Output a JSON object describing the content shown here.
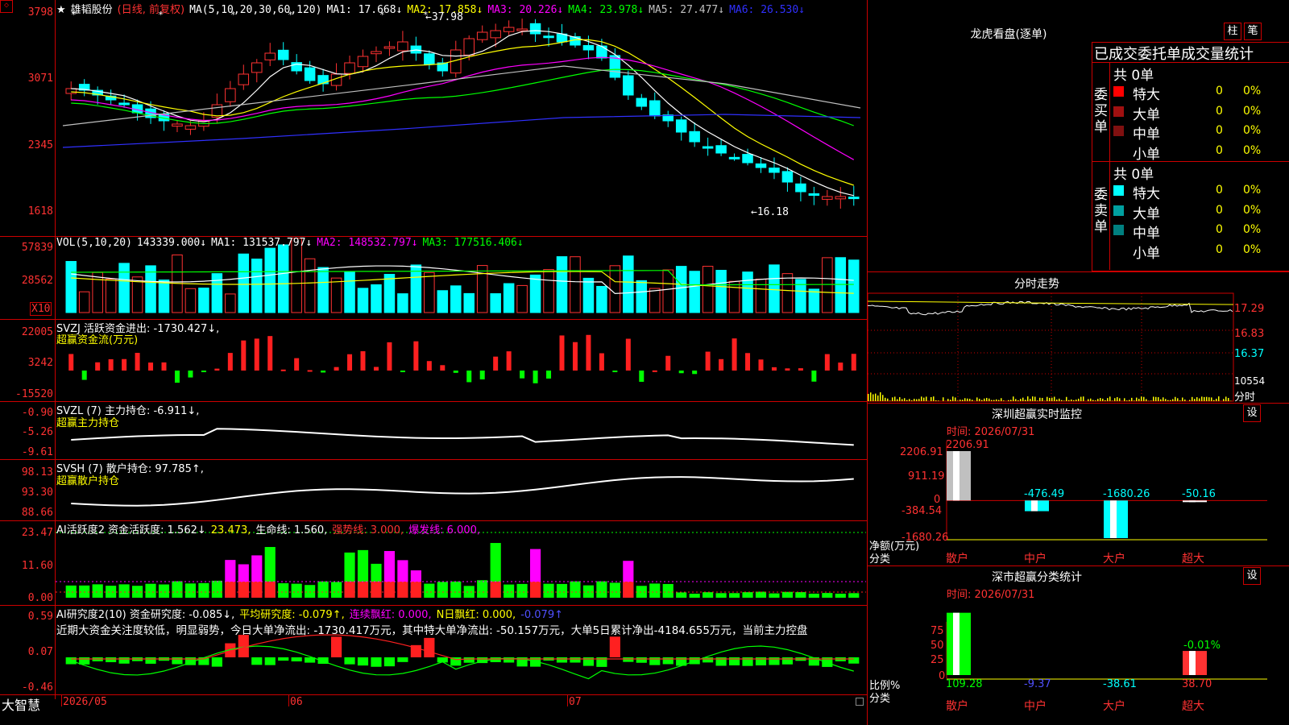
{
  "main": {
    "stock_name": "雄韬股份",
    "mode": "(日线, 前复权)",
    "ma_header": "MA(5,10,20,30,60,120)",
    "ma": [
      {
        "label": "MA1: 17.668↓",
        "color": "#ffffff"
      },
      {
        "label": "MA2: 17.858↓",
        "color": "#ffff00"
      },
      {
        "label": "MA3: 20.226↓",
        "color": "#ff00ff"
      },
      {
        "label": "MA4: 23.978↓",
        "color": "#00ff00"
      },
      {
        "label": "MA5: 27.477↓",
        "color": "#c0c0c0"
      },
      {
        "label": "MA6: 26.530↓",
        "color": "#3030ff"
      }
    ],
    "high_label": "←37.98",
    "low_label": "←16.18",
    "y_labels": [
      "3798",
      "3071",
      "2345",
      "1618"
    ]
  },
  "vol": {
    "header": "VOL(5,10,20)",
    "value": "143339.000↓",
    "ma": [
      {
        "label": "MA1: 131537.797↓",
        "color": "#ffffff"
      },
      {
        "label": "MA2: 148532.797↓",
        "color": "#ff00ff"
      },
      {
        "label": "MA3: 177516.406↓",
        "color": "#00ff00"
      }
    ],
    "y_labels": [
      "57839",
      "28562"
    ],
    "unit": "X10"
  },
  "svzj": {
    "header": "SVZJ  活跃资金进出: -1730.427↓,",
    "subtitle": "超赢资金流(万元)",
    "y_labels": [
      "22005",
      "3242",
      "-15520"
    ]
  },
  "svzl": {
    "header": "SVZL (7) 主力持仓: -6.911↓,",
    "subtitle": "超赢主力持仓",
    "y_labels": [
      "-0.90",
      "-5.26",
      "-9.61"
    ]
  },
  "svsh": {
    "header": "SVSH (7) 散户持仓: 97.785↑,",
    "subtitle": "超赢散户持仓",
    "y_labels": [
      "98.13",
      "93.30",
      "88.66"
    ]
  },
  "ai2": {
    "header": "AI活跃度2 资金活跃度: 1.562↓",
    "v2": "23.473,",
    "life": "生命线: 1.560,",
    "strong": "强势线: 3.000,",
    "burst": "爆发线: 6.000,",
    "y_labels": [
      "23.47",
      "11.60",
      "0.00"
    ]
  },
  "research": {
    "header": "AI研究度2(10) 资金研究度: -0.085↓,",
    "avg": "平均研究度: -0.079↑,",
    "cont": "连续飘红: 0.000,",
    "nday": "N日飘红: 0.000,",
    "last": "-0.079↑",
    "comment": "近期大资金关注度较低，明显弱势，今日大单净流出: -1730.417万元，其中特大单净流出: -50.157万元，大单5日累计净出-4184.655万元，当前主力控盘",
    "y_labels": [
      "0.59",
      "0.07",
      "-0.46"
    ]
  },
  "xaxis": {
    "logo": "大智慧",
    "dates": [
      "2026/05",
      "06",
      "07"
    ]
  },
  "right": {
    "lhb_title": "龙虎看盘(逐单)",
    "btn_bar": "柱",
    "btn_pen": "笔",
    "table_title": "已成交委托单成交量统计",
    "buy_label": "委买单",
    "sell_label": "委卖单",
    "buy_total": "共 0单",
    "sell_total": "共 0单",
    "buy_rows": [
      {
        "name": "特大",
        "count": "0",
        "pct": "0%",
        "color": "#ff0000"
      },
      {
        "name": "大单",
        "count": "0",
        "pct": "0%",
        "color": "#a01010"
      },
      {
        "name": "中单",
        "count": "0",
        "pct": "0%",
        "color": "#801010"
      },
      {
        "name": "小单",
        "count": "0",
        "pct": "0%",
        "color": "#000000"
      }
    ],
    "sell_rows": [
      {
        "name": "特大",
        "count": "0",
        "pct": "0%",
        "color": "#00ffff"
      },
      {
        "name": "大单",
        "count": "0",
        "pct": "0%",
        "color": "#00a0a0"
      },
      {
        "name": "中单",
        "count": "0",
        "pct": "0%",
        "color": "#008080"
      },
      {
        "name": "小单",
        "count": "0",
        "pct": "0%",
        "color": "#000000"
      }
    ],
    "intraday_title": "分时走势",
    "intraday_y": [
      "17.29",
      "16.83",
      "16.37",
      "10554"
    ],
    "intraday_unit": "分时",
    "monitor_title": "深圳超赢实时监控",
    "monitor_time": "时间: 2026/07/31",
    "monitor_y": [
      "2206.91",
      "911.19",
      "0",
      "-384.54",
      "-1680.26"
    ],
    "monitor_axis_label": "净额(万元)",
    "monitor_category_label": "分类",
    "monitor_values": [
      {
        "name": "散户",
        "value": "2206.91"
      },
      {
        "name": "中户",
        "value": "-476.49"
      },
      {
        "name": "大户",
        "value": "-1680.26"
      },
      {
        "name": "超大",
        "value": "-50.16"
      }
    ],
    "stats_title": "深市超赢分类统计",
    "stats_time": "时间: 2026/07/31",
    "stats_y": [
      "75",
      "50",
      "25",
      "0"
    ],
    "stats_axis_label": "比例%",
    "stats_category_label": "分类",
    "stats_top_label": "-0.01%",
    "stats_values": [
      {
        "name": "散户",
        "value": "109.28"
      },
      {
        "name": "中户",
        "value": "-9.37"
      },
      {
        "name": "大户",
        "value": "-38.61"
      },
      {
        "name": "超大",
        "value": "38.70"
      }
    ],
    "settings_btn": "设"
  }
}
